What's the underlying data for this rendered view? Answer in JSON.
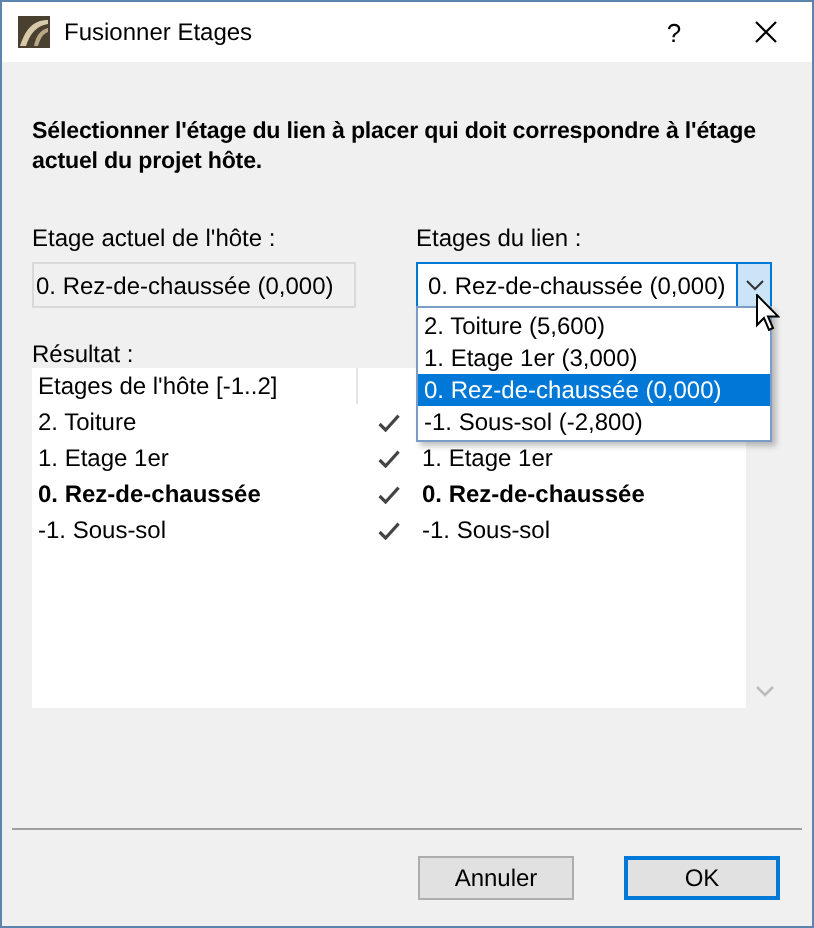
{
  "window": {
    "title": "Fusionner Etages",
    "help": "?"
  },
  "instruction": "Sélectionner l'étage du lien à placer qui doit correspondre à l'étage actuel du projet hôte.",
  "host_label": "Etage actuel de l'hôte :",
  "host_value": "0. Rez-de-chaussée (0,000)",
  "link_label": "Etages du lien :",
  "link_combo": {
    "value": "0. Rez-de-chaussée (0,000)",
    "expanded": true,
    "options": [
      {
        "label": "2. Toiture (5,600)",
        "selected": false
      },
      {
        "label": "1. Etage 1er (3,000)",
        "selected": false
      },
      {
        "label": "0. Rez-de-chaussée (0,000)",
        "selected": true
      },
      {
        "label": "-1. Sous-sol (-2,800)",
        "selected": false
      }
    ]
  },
  "result_label": "Résultat :",
  "table": {
    "header": "Etages de l'hôte [-1..2]",
    "rows": [
      {
        "host": "2. Toiture",
        "matched": true,
        "current": false
      },
      {
        "host": "1. Etage 1er",
        "matched": true,
        "current": false,
        "link": "1. Etage 1er"
      },
      {
        "host": "0. Rez-de-chaussée",
        "matched": true,
        "current": true,
        "link": "0. Rez-de-chaussée"
      },
      {
        "host": "-1. Sous-sol",
        "matched": true,
        "current": false,
        "link": "-1. Sous-sol"
      }
    ]
  },
  "buttons": [
    {
      "label": "Annuler",
      "default": false
    },
    {
      "label": "OK",
      "default": true
    }
  ]
}
